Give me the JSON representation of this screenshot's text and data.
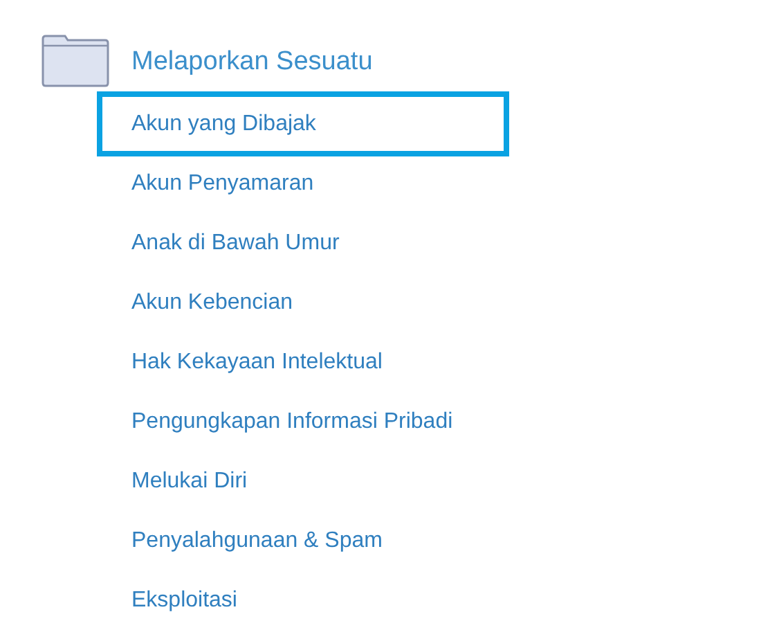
{
  "section": {
    "title": "Melaporkan Sesuatu",
    "items": [
      {
        "label": "Akun yang Dibajak",
        "selected": true
      },
      {
        "label": "Akun Penyamaran",
        "selected": false
      },
      {
        "label": "Anak di Bawah Umur",
        "selected": false
      },
      {
        "label": "Akun Kebencian",
        "selected": false
      },
      {
        "label": "Hak Kekayaan Intelektual",
        "selected": false
      },
      {
        "label": "Pengungkapan Informasi Pribadi",
        "selected": false
      },
      {
        "label": "Melukai Diri",
        "selected": false
      },
      {
        "label": "Penyalahgunaan & Spam",
        "selected": false
      },
      {
        "label": "Eksploitasi",
        "selected": false
      }
    ]
  }
}
